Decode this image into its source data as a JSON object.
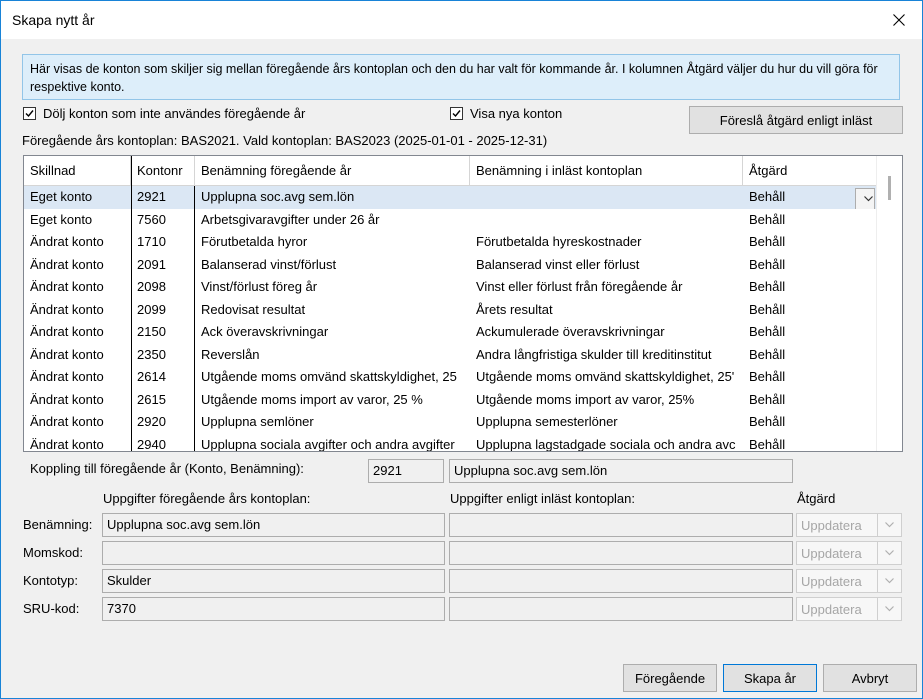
{
  "window": {
    "title": "Skapa nytt år"
  },
  "info": {
    "text": "Här visas de konton som skiljer sig mellan föregående års kontoplan och den du har valt för kommande år. I kolumnen Åtgärd väljer du hur du vill göra för respektive konto."
  },
  "options": {
    "hide_unused_label": "Dölj konton som inte användes föregående år",
    "hide_unused_checked": true,
    "show_new_label": "Visa nya konton",
    "show_new_checked": true,
    "suggest_button": "Föreslå åtgärd enligt inläst"
  },
  "plan_text": "Föregående års kontoplan: BAS2021. Vald kontoplan: BAS2023 (2025-01-01 - 2025-12-31)",
  "grid": {
    "headers": [
      "Skillnad",
      "Kontonr",
      "Benämning föregående år",
      "Benämning i inläst kontoplan",
      "Åtgärd"
    ],
    "rows": [
      [
        "Eget konto",
        "2921",
        "Upplupna soc.avg sem.lön",
        "",
        "Behåll"
      ],
      [
        "Eget konto",
        "7560",
        "Arbetsgivaravgifter under 26 år",
        "",
        "Behåll"
      ],
      [
        "Ändrat konto",
        "1710",
        "Förutbetalda hyror",
        "Förutbetalda hyreskostnader",
        "Behåll"
      ],
      [
        "Ändrat konto",
        "2091",
        "Balanserad vinst/förlust",
        "Balanserad vinst eller förlust",
        "Behåll"
      ],
      [
        "Ändrat konto",
        "2098",
        "Vinst/förlust föreg år",
        "Vinst eller förlust från föregående år",
        "Behåll"
      ],
      [
        "Ändrat konto",
        "2099",
        "Redovisat resultat",
        "Årets resultat",
        "Behåll"
      ],
      [
        "Ändrat konto",
        "2150",
        "Ack överavskrivningar",
        "Ackumulerade överavskrivningar",
        "Behåll"
      ],
      [
        "Ändrat konto",
        "2350",
        "Reverslån",
        "Andra långfristiga skulder till kreditinstitut",
        "Behåll"
      ],
      [
        "Ändrat konto",
        "2614",
        "Utgående moms omvänd skattskyldighet, 25",
        "Utgående moms omvänd skattskyldighet, 25'",
        "Behåll"
      ],
      [
        "Ändrat konto",
        "2615",
        "Utgående moms import av varor, 25 %",
        "Utgående moms import av varor, 25%",
        "Behåll"
      ],
      [
        "Ändrat konto",
        "2920",
        "Upplupna semlöner",
        "Upplupna semesterlöner",
        "Behåll"
      ],
      [
        "Ändrat konto",
        "2940",
        "Upplupna sociala avgifter och andra avgifter",
        "Upplupna lagstadgade sociala och andra avc",
        "Behåll"
      ]
    ]
  },
  "details": {
    "link_label": "Koppling till föregående år (Konto, Benämning):",
    "link_account": "2921",
    "link_name": "Upplupna soc.avg sem.lön",
    "prev_header": "Uppgifter föregående års kontoplan:",
    "new_header": "Uppgifter enligt inläst kontoplan:",
    "action_header": "Åtgärd",
    "fields": [
      {
        "label": "Benämning:",
        "prev": "Upplupna soc.avg sem.lön",
        "new": "",
        "action": "Uppdatera"
      },
      {
        "label": "Momskod:",
        "prev": "",
        "new": "",
        "action": "Uppdatera"
      },
      {
        "label": "Kontotyp:",
        "prev": "Skulder",
        "new": "",
        "action": "Uppdatera"
      },
      {
        "label": "SRU-kod:",
        "prev": "7370",
        "new": "",
        "action": "Uppdatera"
      }
    ]
  },
  "footer": {
    "prev_button": "Föregående",
    "create_button": "Skapa år",
    "cancel_button": "Avbryt"
  }
}
